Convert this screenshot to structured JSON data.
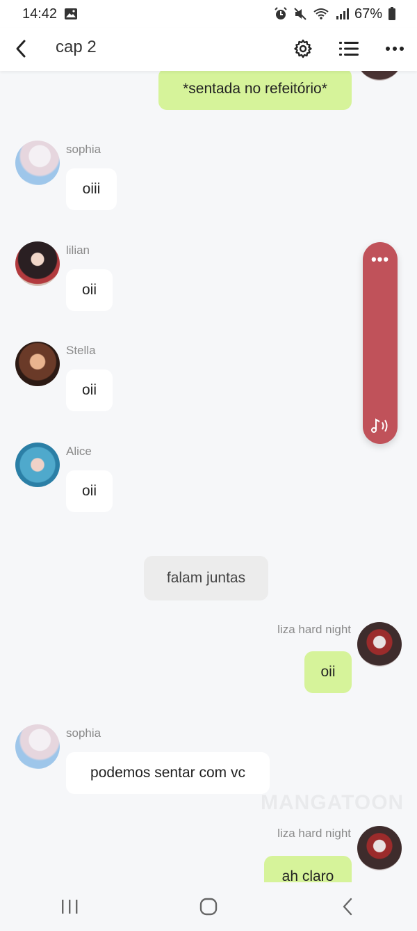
{
  "status_bar": {
    "time": "14:42",
    "battery": "67%",
    "icons": [
      "image-icon",
      "alarm-icon",
      "mute-icon",
      "wifi-icon",
      "signal-icon",
      "battery-icon"
    ]
  },
  "header": {
    "title": "cap 2",
    "icons": [
      "back-icon",
      "settings-icon",
      "list-icon",
      "more-icon"
    ]
  },
  "messages": [
    {
      "side": "right",
      "sender": "",
      "text": "*sentada no refeitório*"
    },
    {
      "side": "left",
      "sender": "sophia",
      "text": "oiii"
    },
    {
      "side": "left",
      "sender": "lilian",
      "text": "oii"
    },
    {
      "side": "left",
      "sender": "Stella",
      "text": "oii"
    },
    {
      "side": "left",
      "sender": "Alice",
      "text": "oii"
    },
    {
      "side": "narration",
      "sender": "",
      "text": "falam juntas"
    },
    {
      "side": "right",
      "sender": "liza hard night",
      "text": "oii"
    },
    {
      "side": "left",
      "sender": "sophia",
      "text": "podemos sentar com vc"
    },
    {
      "side": "right",
      "sender": "liza hard night",
      "text": "ah claro"
    }
  ],
  "watermark": "MANGATOON",
  "audio_panel": {
    "dots": "•••",
    "icon": "music-voice-icon",
    "color": "#c0525a"
  },
  "colors": {
    "bubble_right": "#d6f39a",
    "bubble_left": "#ffffff",
    "background": "#f6f7f9"
  },
  "nav_bar": {
    "icons": [
      "recent-apps-icon",
      "home-icon",
      "nav-back-icon"
    ]
  }
}
